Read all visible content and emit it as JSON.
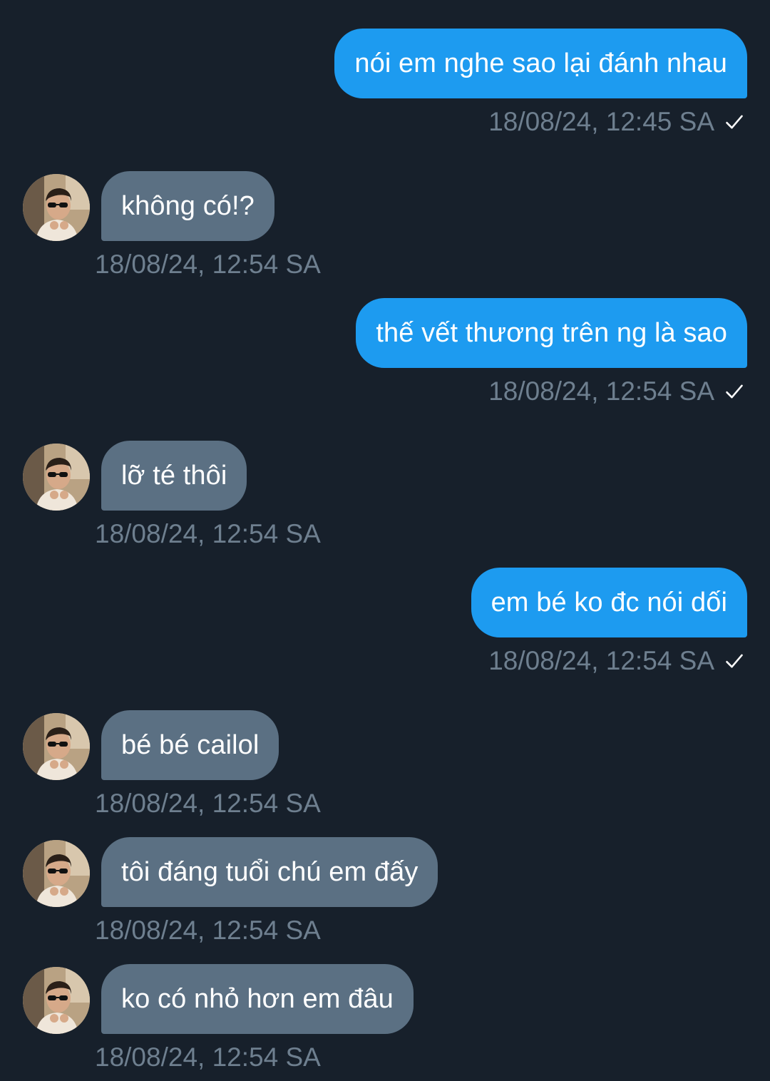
{
  "messages": [
    {
      "side": "out",
      "text": "nói em nghe sao lại đánh nhau",
      "time": "18/08/24, 12:45 SA",
      "status_icon": "check-icon"
    },
    {
      "side": "in",
      "text": "không có!?",
      "time": "18/08/24, 12:54 SA"
    },
    {
      "side": "out",
      "text": "thế vết thương trên ng là sao",
      "time": "18/08/24, 12:54 SA",
      "status_icon": "check-icon"
    },
    {
      "side": "in",
      "text": "lỡ té thôi",
      "time": "18/08/24, 12:54 SA"
    },
    {
      "side": "out",
      "text": "em bé ko đc nói dối",
      "time": "18/08/24, 12:54 SA",
      "status_icon": "check-icon"
    },
    {
      "side": "in",
      "text": "bé bé cailol",
      "time": "18/08/24, 12:54 SA"
    },
    {
      "side": "in",
      "text": "tôi đáng tuổi chú em đấy",
      "time": "18/08/24, 12:54 SA"
    },
    {
      "side": "in",
      "text": "ko có nhỏ hơn em đâu",
      "time": "18/08/24, 12:54 SA"
    }
  ],
  "colors": {
    "background": "#17202b",
    "outgoing_bubble": "#1d9bf0",
    "incoming_bubble": "#5b7083",
    "timestamp": "#6e7f8f"
  }
}
